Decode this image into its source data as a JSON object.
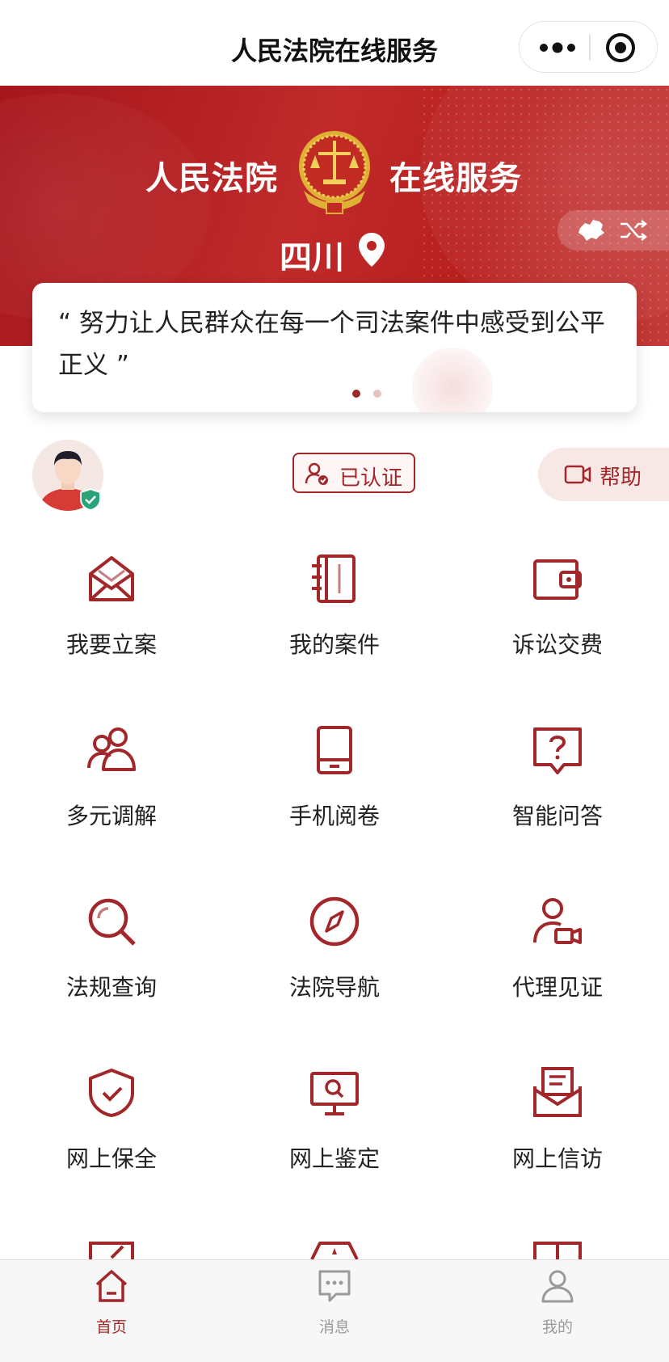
{
  "navbar": {
    "title": "人民法院在线服务"
  },
  "banner": {
    "title_left": "人民法院",
    "title_right": "在线服务",
    "region": "四川"
  },
  "quote": {
    "text": "“ 努力让人民群众在每一个司法案件中感受到公平正义 ”",
    "active_slide": 1,
    "slides": 2
  },
  "user": {
    "verified_label": "已认证",
    "help_label": "帮助"
  },
  "services": [
    {
      "label": "我要立案",
      "icon": "envelope-icon"
    },
    {
      "label": "我的案件",
      "icon": "notebook-icon"
    },
    {
      "label": "诉讼交费",
      "icon": "wallet-icon"
    },
    {
      "label": "多元调解",
      "icon": "people-icon"
    },
    {
      "label": "手机阅卷",
      "icon": "tablet-icon"
    },
    {
      "label": "智能问答",
      "icon": "question-icon"
    },
    {
      "label": "法规查询",
      "icon": "search-icon"
    },
    {
      "label": "法院导航",
      "icon": "compass-icon"
    },
    {
      "label": "代理见证",
      "icon": "user-video-icon"
    },
    {
      "label": "网上保全",
      "icon": "shield-check-icon"
    },
    {
      "label": "网上鉴定",
      "icon": "monitor-search-icon"
    },
    {
      "label": "网上信访",
      "icon": "mail-letter-icon"
    }
  ],
  "tabbar": {
    "items": [
      {
        "label": "首页",
        "icon": "home-icon",
        "active": true
      },
      {
        "label": "消息",
        "icon": "message-icon",
        "active": false
      },
      {
        "label": "我的",
        "icon": "user-icon",
        "active": false
      }
    ]
  },
  "colors": {
    "primary": "#a2272a",
    "banner": "#b8201f",
    "inactive": "#9a9a9a"
  }
}
